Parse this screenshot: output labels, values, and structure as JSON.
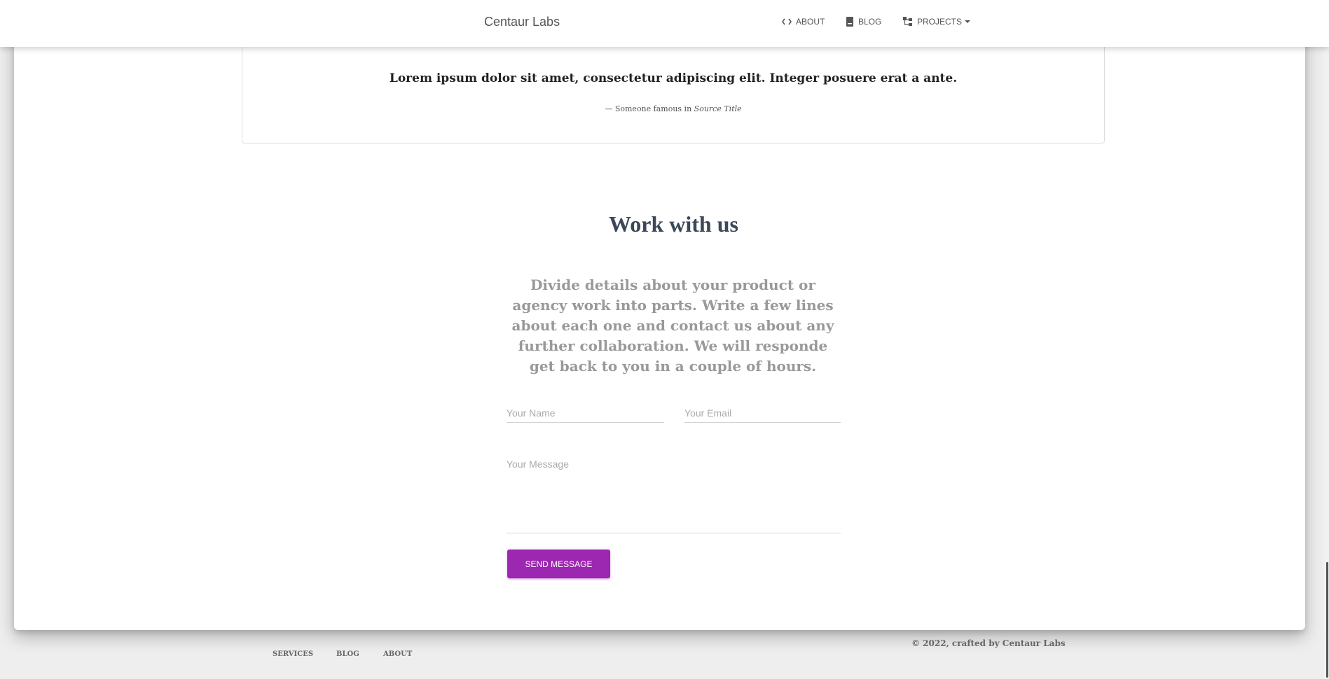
{
  "navbar": {
    "brand": "Centaur Labs",
    "items": [
      {
        "label": "About",
        "icon": "code-icon"
      },
      {
        "label": "Blog",
        "icon": "book-icon"
      },
      {
        "label": "Projects",
        "icon": "sitemap-icon",
        "dropdown": true
      }
    ]
  },
  "quote": {
    "text": "Lorem ipsum dolor sit amet, consectetur adipiscing elit. Integer posuere erat a ante.",
    "attribution_prefix": "— Someone famous in",
    "source_title": "Source Title"
  },
  "contact": {
    "title": "Work with us",
    "description": "Divide details about your product or agency work into parts. Write a few lines about each one and contact us about any further collaboration. We will responde get back to you in a couple of hours.",
    "name_placeholder": "Your Name",
    "email_placeholder": "Your Email",
    "message_placeholder": "Your Message",
    "send_label": "Send Message"
  },
  "footer": {
    "links": [
      "Services",
      "Blog",
      "About"
    ],
    "copyright": "© 2022, crafted by Centaur Labs"
  },
  "colors": {
    "accent": "#9c27b0",
    "title": "#3c4858",
    "muted": "#999999"
  }
}
